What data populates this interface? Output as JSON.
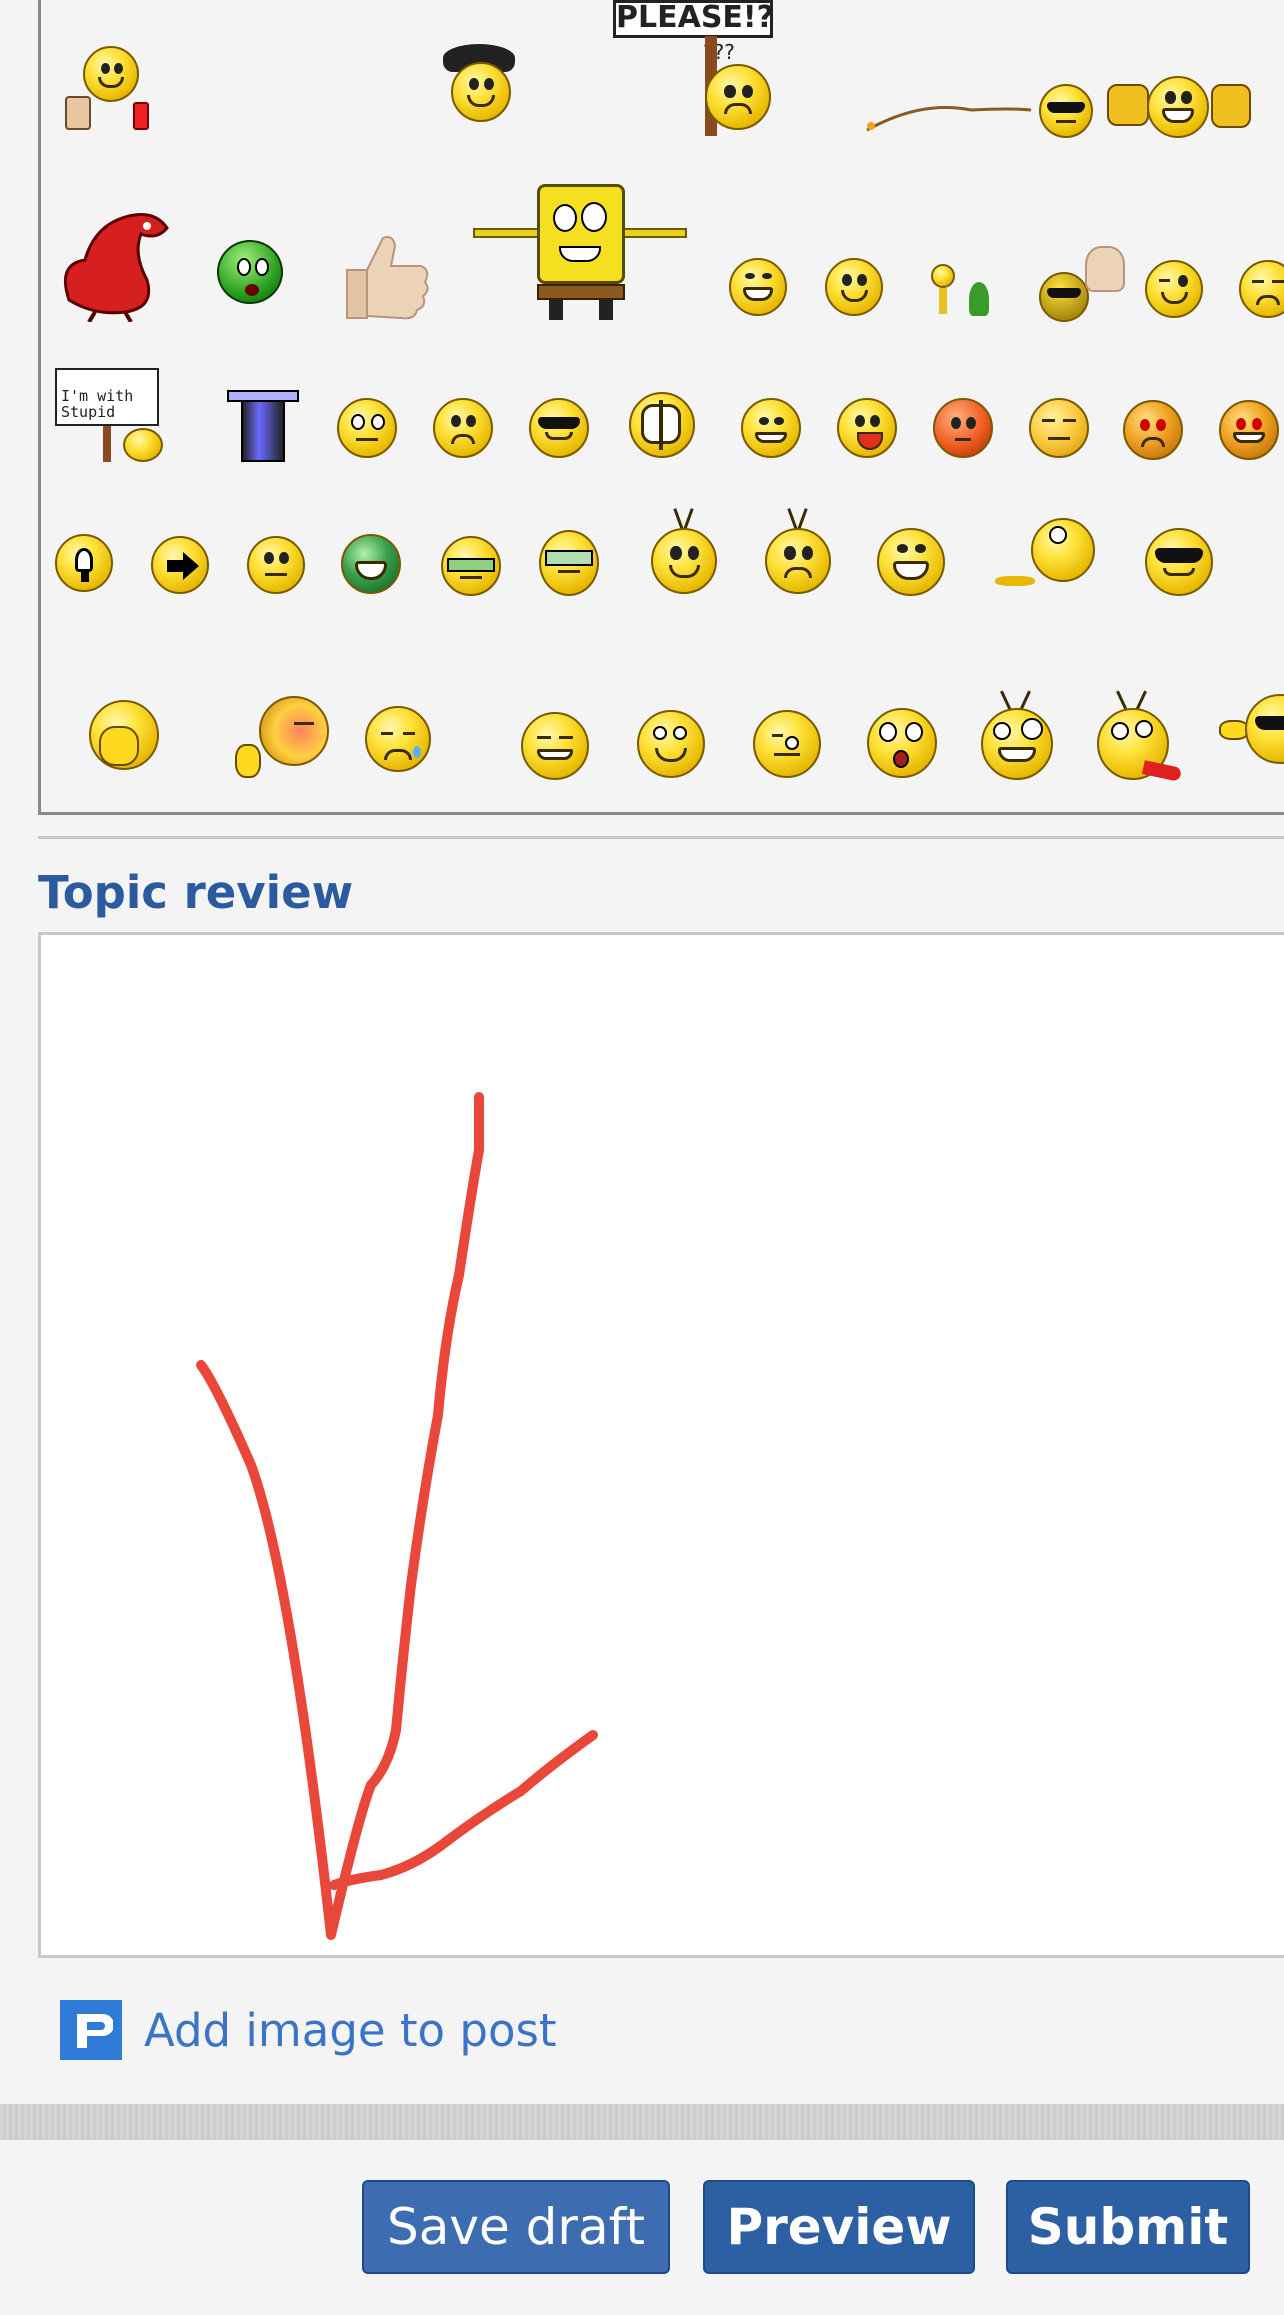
{
  "smilies": {
    "sign_please": "PLEASE!?",
    "sign_please_sub": "???",
    "sign_stupid": "I'm with Stupid",
    "items": [
      "drinking",
      "police",
      "please-sign",
      "fishing",
      "thumbs-party",
      "dragon",
      "green-alien",
      "thumbs-up",
      "spongebob",
      "grin",
      "smile",
      "dancing",
      "headbang",
      "wink",
      "shy",
      "with-stupid",
      "hat",
      "eek",
      "confused",
      "cool",
      "helmet",
      "mad",
      "tongue",
      "red-face",
      "annoyed",
      "devil",
      "evil",
      "lightbulb",
      "arrow",
      "neutral",
      "green-grin",
      "nerd",
      "geek",
      "antenna-happy",
      "antenna-sad",
      "big-grin",
      "rolling",
      "sunglasses",
      "facepalm",
      "blush",
      "sad-tear",
      "sly",
      "rolleyes",
      "drool",
      "shock",
      "crazy",
      "tongue-out",
      "pointing"
    ]
  },
  "topic_review": {
    "title": "Topic review"
  },
  "add_image": {
    "label": "Add image to post",
    "icon": "p-icon"
  },
  "buttons": {
    "save_draft": "Save draft",
    "preview": "Preview",
    "submit": "Submit"
  },
  "colors": {
    "accent": "#2d5fa3",
    "title": "#2c5a9e",
    "annotation": "#e8473a"
  }
}
